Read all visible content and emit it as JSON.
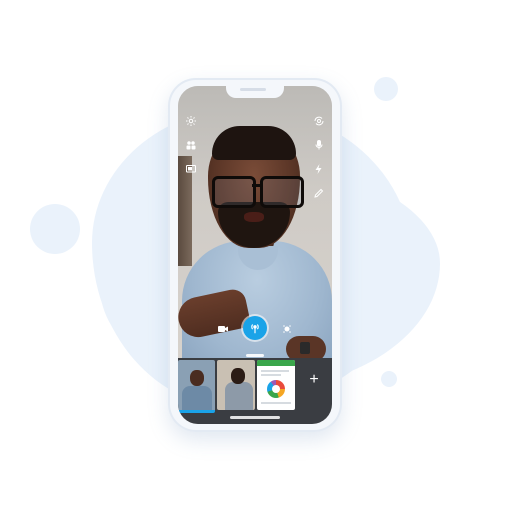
{
  "app": {
    "name": "Video call",
    "accent_color": "#1aa3e8",
    "background_blob_color": "#eaf2fb"
  },
  "left_toolbar": [
    {
      "icon": "gear-icon"
    },
    {
      "icon": "participants-icon"
    },
    {
      "icon": "screen-share-icon"
    }
  ],
  "right_toolbar": [
    {
      "icon": "switch-camera-icon"
    },
    {
      "icon": "microphone-icon"
    },
    {
      "icon": "flashlight-icon"
    },
    {
      "icon": "pen-tool-icon"
    }
  ],
  "bottom_controls": {
    "video_icon": "video-camera-icon",
    "broadcast_icon": "broadcast-icon",
    "effects_icon": "effects-icon"
  },
  "filmstrip": {
    "add_label": "+",
    "thumbnails": [
      {
        "kind": "video",
        "selected": true
      },
      {
        "kind": "video",
        "selected": false
      },
      {
        "kind": "document",
        "selected": false
      }
    ]
  }
}
